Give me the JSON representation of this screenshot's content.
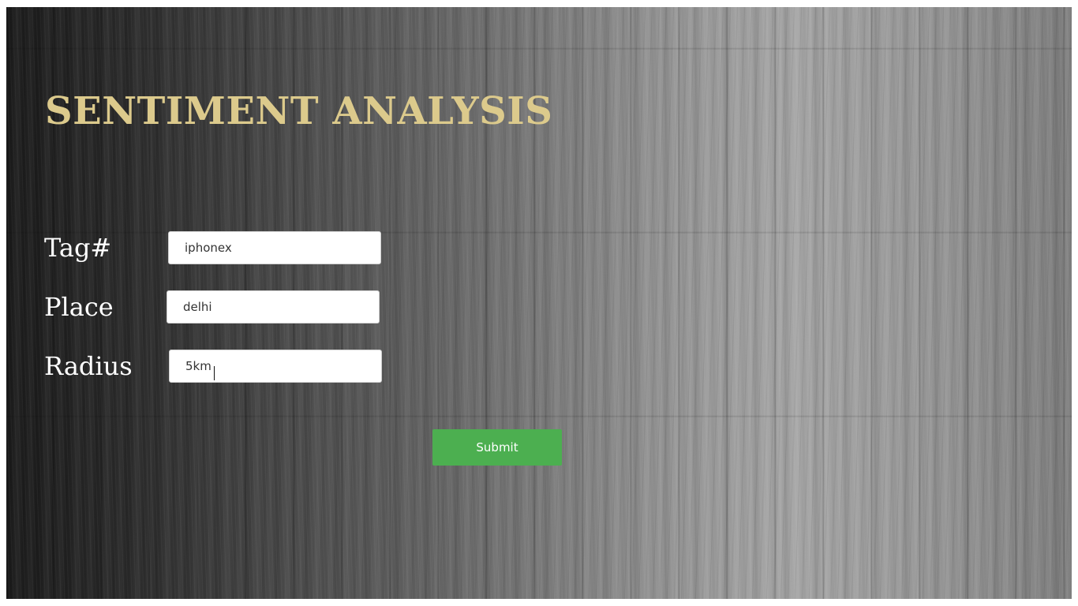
{
  "header": {
    "title": "SENTIMENT ANALYSIS"
  },
  "form": {
    "tag": {
      "label": "Tag#",
      "value": "iphonex"
    },
    "place": {
      "label": "Place",
      "value": "delhi"
    },
    "radius": {
      "label": "Radius",
      "value": "5km"
    },
    "submit_label": "Submit"
  },
  "colors": {
    "title": "#dcca8c",
    "submit_bg": "#4caf50",
    "label_text": "#ffffff"
  }
}
